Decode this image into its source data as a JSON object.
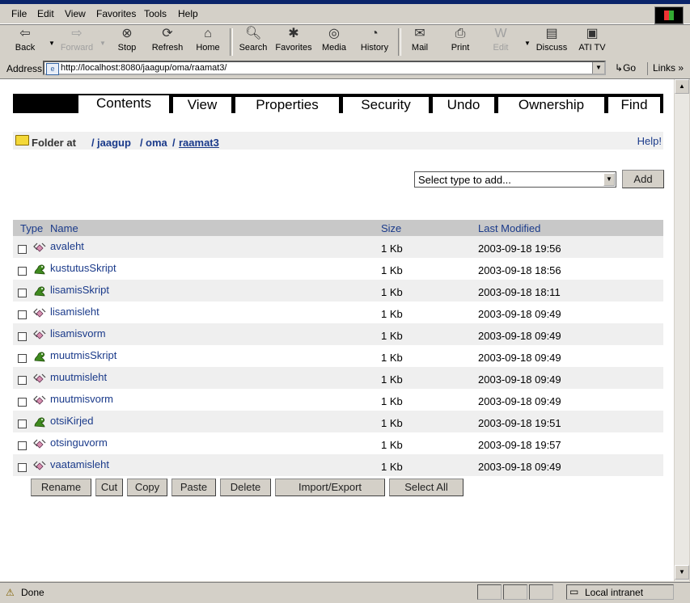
{
  "menu": [
    "File",
    "Edit",
    "View",
    "Favorites",
    "Tools",
    "Help"
  ],
  "toolbar": {
    "back": "Back",
    "forward": "Forward",
    "stop": "Stop",
    "refresh": "Refresh",
    "home": "Home",
    "search": "Search",
    "favorites": "Favorites",
    "media": "Media",
    "history": "History",
    "mail": "Mail",
    "print": "Print",
    "edit": "Edit",
    "discuss": "Discuss",
    "atitv": "ATI TV"
  },
  "address": {
    "label": "Address",
    "url": "http://localhost:8080/jaagup/oma/raamat3/",
    "go": "Go",
    "links": "Links"
  },
  "tabs": [
    "Contents",
    "View",
    "Properties",
    "Security",
    "Undo",
    "Ownership",
    "Find"
  ],
  "folder": {
    "label": "Folder at",
    "sep": "/",
    "path": [
      "jaagup",
      "oma",
      "raamat3"
    ],
    "help": "Help!"
  },
  "add": {
    "placeholder": "Select type to add...",
    "button": "Add"
  },
  "table": {
    "headers": {
      "type": "Type",
      "name": "Name",
      "size": "Size",
      "modified": "Last Modified"
    },
    "rows": [
      {
        "name": "avaleht",
        "icon": "page-icon",
        "size": "1 Kb",
        "modified": "2003-09-18 19:56"
      },
      {
        "name": "kustutusSkript",
        "icon": "script-icon",
        "size": "1 Kb",
        "modified": "2003-09-18 18:56"
      },
      {
        "name": "lisamisSkript",
        "icon": "script-icon",
        "size": "1 Kb",
        "modified": "2003-09-18 18:11"
      },
      {
        "name": "lisamisleht",
        "icon": "page-icon",
        "size": "1 Kb",
        "modified": "2003-09-18 09:49"
      },
      {
        "name": "lisamisvorm",
        "icon": "page-icon",
        "size": "1 Kb",
        "modified": "2003-09-18 09:49"
      },
      {
        "name": "muutmisSkript",
        "icon": "script-icon",
        "size": "1 Kb",
        "modified": "2003-09-18 09:49"
      },
      {
        "name": "muutmisleht",
        "icon": "page-icon",
        "size": "1 Kb",
        "modified": "2003-09-18 09:49"
      },
      {
        "name": "muutmisvorm",
        "icon": "page-icon",
        "size": "1 Kb",
        "modified": "2003-09-18 09:49"
      },
      {
        "name": "otsiKirjed",
        "icon": "script-icon",
        "size": "1 Kb",
        "modified": "2003-09-18 19:51"
      },
      {
        "name": "otsinguvorm",
        "icon": "page-icon",
        "size": "1 Kb",
        "modified": "2003-09-18 19:57"
      },
      {
        "name": "vaatamisleht",
        "icon": "page-icon",
        "size": "1 Kb",
        "modified": "2003-09-18 09:49"
      }
    ]
  },
  "actions": [
    "Rename",
    "Cut",
    "Copy",
    "Paste",
    "Delete",
    "Import/Export",
    "Select All"
  ],
  "status": {
    "text": "Done",
    "zone": "Local intranet"
  }
}
